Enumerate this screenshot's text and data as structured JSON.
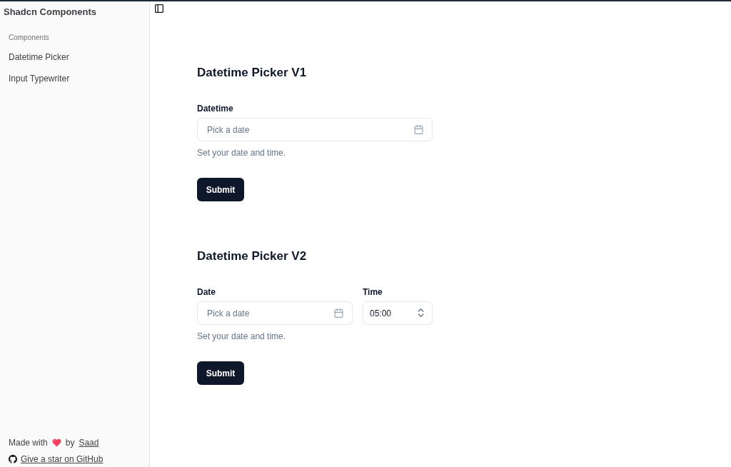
{
  "sidebar": {
    "title": "Shadcn Components",
    "group_label": "Components",
    "items": [
      {
        "label": "Datetime Picker"
      },
      {
        "label": "Input Typewriter"
      }
    ],
    "footer": {
      "made_with": "Made with",
      "by": "by",
      "author": "Saad",
      "github_link": "Give a star on GitHub"
    }
  },
  "sections": [
    {
      "title": "Datetime Picker V1",
      "fields": [
        {
          "kind": "date",
          "label": "Datetime",
          "placeholder": "Pick a date"
        }
      ],
      "description": "Set your date and time.",
      "submit": "Submit"
    },
    {
      "title": "Datetime Picker V2",
      "fields": [
        {
          "kind": "date",
          "label": "Date",
          "placeholder": "Pick a date"
        },
        {
          "kind": "time",
          "label": "Time",
          "value": "05:00"
        }
      ],
      "description": "Set your date and time.",
      "submit": "Submit"
    }
  ]
}
